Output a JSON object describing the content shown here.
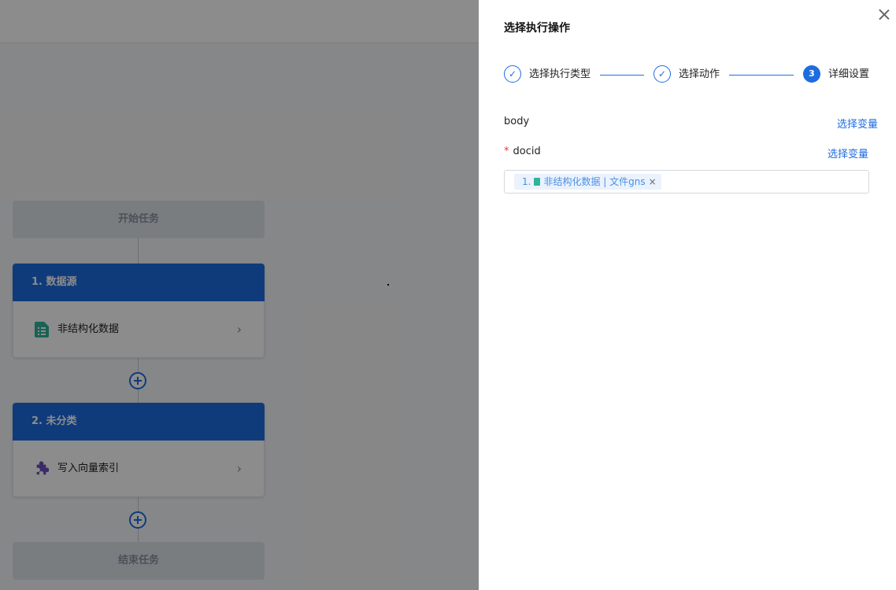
{
  "canvas": {
    "start_label": "开始任务",
    "end_label": "结束任务",
    "nodes": [
      {
        "header": "1. 数据源",
        "item_label": "非结构化数据",
        "item_icon": "spreadsheet-icon"
      },
      {
        "header": "2. 未分类",
        "item_label": "写入向量索引",
        "item_icon": "puzzle-icon"
      }
    ]
  },
  "drawer": {
    "title": "选择执行操作",
    "steps": [
      {
        "label": "选择执行类型",
        "status": "done"
      },
      {
        "label": "选择动作",
        "status": "done"
      },
      {
        "number": "3",
        "label": "详细设置",
        "status": "current"
      }
    ],
    "fields": [
      {
        "name": "body",
        "required": false,
        "link": "选择变量"
      },
      {
        "name": "docid",
        "required": true,
        "link": "选择变量",
        "tag": {
          "prefix": "1.",
          "text": "非结构化数据 | 文件gns"
        }
      }
    ]
  },
  "colors": {
    "primary": "#1d6ce0",
    "required": "#e23c39",
    "file_icon": "#2fb39a",
    "puzzle_icon": "#6b4fbb"
  }
}
